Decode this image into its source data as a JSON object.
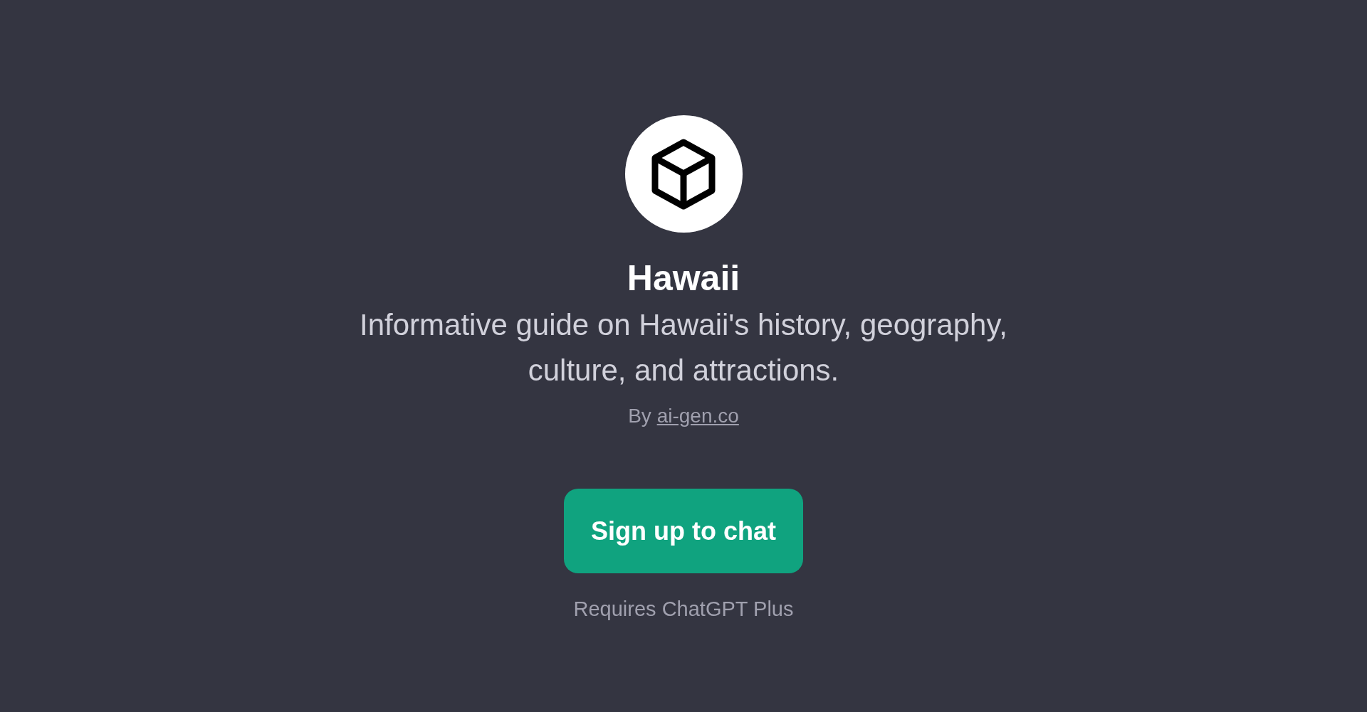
{
  "gpt": {
    "name": "Hawaii",
    "description": "Informative guide on Hawaii's history, geography, culture, and attractions.",
    "by_label": "By",
    "author_link": "ai-gen.co"
  },
  "signup_button": {
    "label": "Sign up to chat"
  },
  "note": "Requires ChatGPT Plus"
}
